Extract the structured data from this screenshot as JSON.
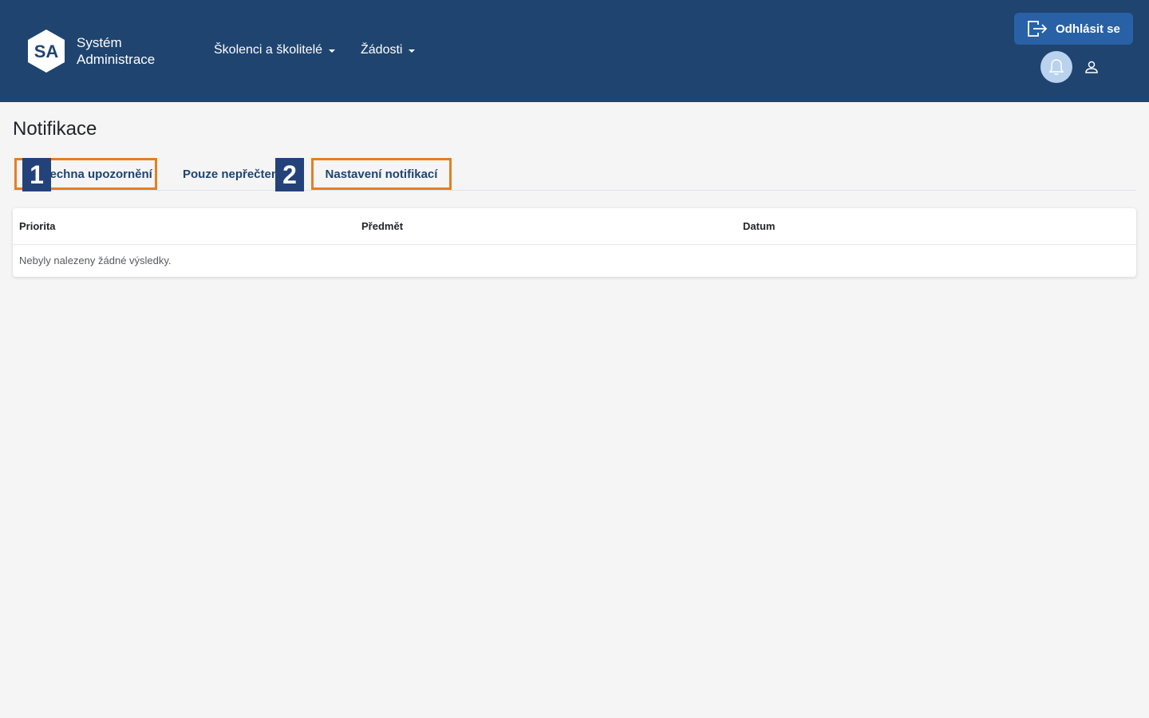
{
  "header": {
    "logo_abbr": "SA",
    "logo_line1": "Systém",
    "logo_line2": "Administrace",
    "nav": [
      {
        "label": "Školenci a školitelé"
      },
      {
        "label": "Žádosti"
      }
    ],
    "logout_label": "Odhlásit se"
  },
  "page": {
    "title": "Notifikace",
    "tabs": [
      {
        "label": "Všechna upozornění"
      },
      {
        "label": "Pouze nepřečtené"
      },
      {
        "label": "Nastavení notifikací"
      }
    ],
    "badges": [
      "1",
      "2"
    ]
  },
  "table": {
    "columns": [
      "Priorita",
      "Předmět",
      "Datum"
    ],
    "empty_message": "Nebyly nalezeny žádné výsledky."
  },
  "colors": {
    "header_bg": "#1f4470",
    "accent": "#2861a6",
    "highlight_border": "#e67e22",
    "badge_bg": "#24427a"
  }
}
